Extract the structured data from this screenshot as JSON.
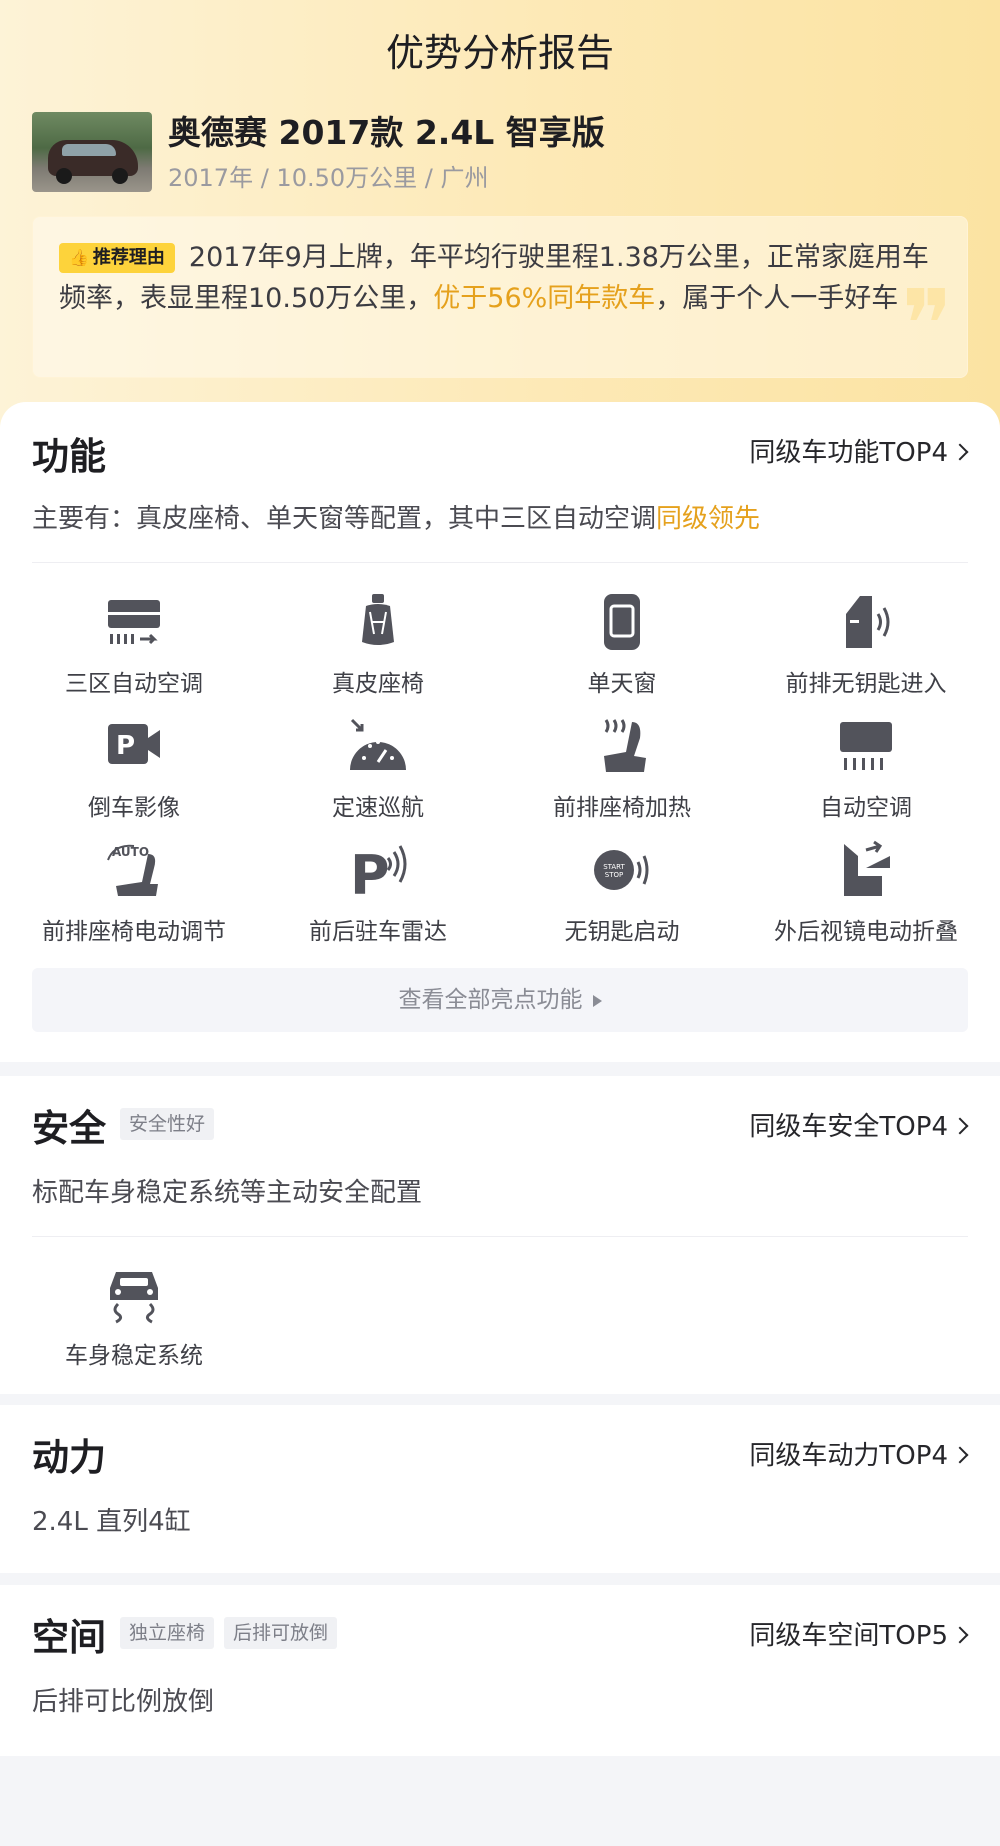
{
  "header": {
    "title": "优势分析报告"
  },
  "car": {
    "name": "奥德赛 2017款 2.4L 智享版",
    "meta": "2017年 / 10.50万公里 / 广州"
  },
  "reason": {
    "tag": "推荐理由",
    "text_before": "2017年9月上牌，年平均行驶里程1.38万公里，正常家庭用车频率，表显里程10.50万公里，",
    "highlight": "优于56%同年款车",
    "text_after": "，属于个人一手好车"
  },
  "function": {
    "title": "功能",
    "link": "同级车功能TOP4",
    "desc_prefix": "主要有：真皮座椅、单天窗等配置，其中三区自动空调",
    "desc_highlight": "同级领先",
    "features": [
      {
        "label": "三区自动空调",
        "icon": "ac-three-zone-icon"
      },
      {
        "label": "真皮座椅",
        "icon": "leather-seat-icon"
      },
      {
        "label": "单天窗",
        "icon": "sunroof-icon"
      },
      {
        "label": "前排无钥匙进入",
        "icon": "keyless-entry-icon"
      },
      {
        "label": "倒车影像",
        "icon": "reverse-camera-icon"
      },
      {
        "label": "定速巡航",
        "icon": "cruise-control-icon"
      },
      {
        "label": "前排座椅加热",
        "icon": "seat-heating-icon"
      },
      {
        "label": "自动空调",
        "icon": "auto-ac-icon"
      },
      {
        "label": "前排座椅电动调节",
        "icon": "power-seat-icon"
      },
      {
        "label": "前后驻车雷达",
        "icon": "parking-radar-icon"
      },
      {
        "label": "无钥匙启动",
        "icon": "keyless-start-icon"
      },
      {
        "label": "外后视镜电动折叠",
        "icon": "mirror-fold-icon"
      }
    ],
    "view_all": "查看全部亮点功能",
    "icon_text": {
      "auto": "AUTO",
      "start": "START",
      "stop": "STOP"
    }
  },
  "safety": {
    "title": "安全",
    "tag": "安全性好",
    "link": "同级车安全TOP4",
    "desc": "标配车身稳定系统等主动安全配置",
    "features": [
      {
        "label": "车身稳定系统",
        "icon": "stability-control-icon"
      }
    ]
  },
  "power": {
    "title": "动力",
    "link": "同级车动力TOP4",
    "desc": "2.4L 直列4缸"
  },
  "space": {
    "title": "空间",
    "tags": [
      "独立座椅",
      "后排可放倒"
    ],
    "link": "同级车空间TOP5",
    "desc": "后排可比例放倒"
  },
  "colors": {
    "accent": "#e5a11d",
    "tag_yellow": "#fdd33b",
    "icon": "#52535b"
  }
}
